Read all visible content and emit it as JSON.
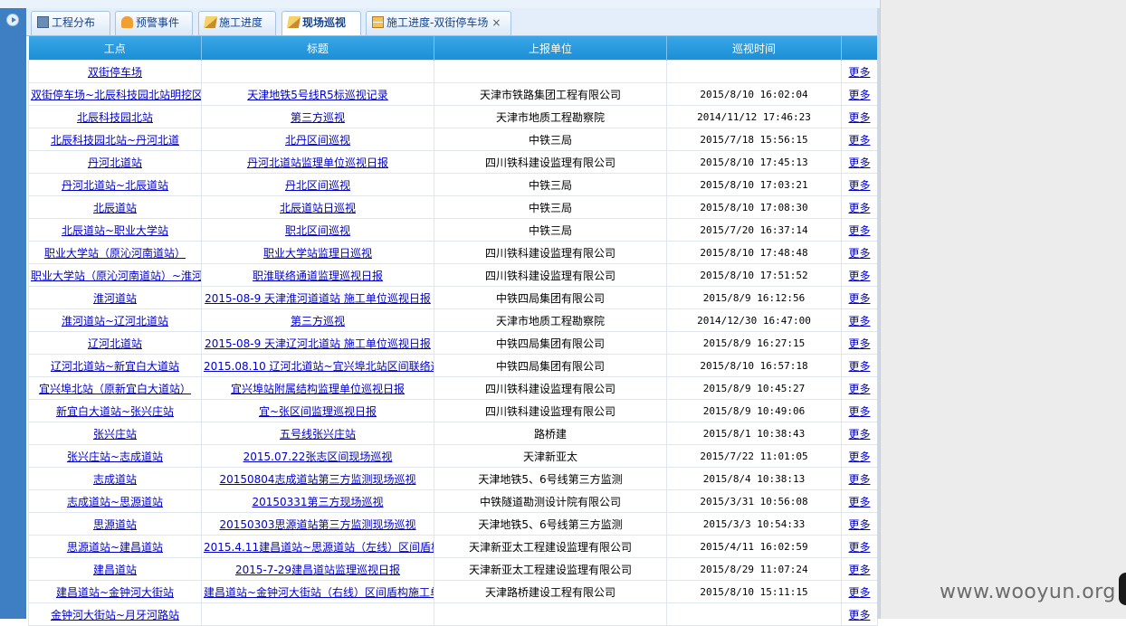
{
  "tabs": [
    {
      "label": "工程分布",
      "icon": "document-icon"
    },
    {
      "label": "预警事件",
      "icon": "bell-icon"
    },
    {
      "label": "施工进度",
      "icon": "pencil-icon"
    },
    {
      "label": "现场巡视",
      "icon": "pencil-icon",
      "active": true
    },
    {
      "label": "施工进度-双街停车场",
      "icon": "hourglass-icon",
      "closable": true,
      "close": "×"
    }
  ],
  "table": {
    "headers": [
      "工点",
      "标题",
      "上报单位",
      "巡视时间",
      ""
    ],
    "more_label": "更多",
    "rows": [
      {
        "site": "双街停车场",
        "title": "",
        "unit": "",
        "time": ""
      },
      {
        "site": "双街停车场~北辰科技园北站明挖区",
        "title": "天津地铁5号线R5标巡视记录",
        "unit": "天津市铁路集团工程有限公司",
        "time": "2015/8/10 16:02:04"
      },
      {
        "site": "北辰科技园北站",
        "title": "第三方巡视",
        "unit": "天津市地质工程勘察院",
        "time": "2014/11/12 17:46:23"
      },
      {
        "site": "北辰科技园北站~丹河北道",
        "title": "北丹区间巡视",
        "unit": "中铁三局",
        "time": "2015/7/18 15:56:15"
      },
      {
        "site": "丹河北道站",
        "title": "丹河北道站监理单位巡视日报",
        "unit": "四川铁科建设监理有限公司",
        "time": "2015/8/10 17:45:13"
      },
      {
        "site": "丹河北道站~北辰道站",
        "title": "丹北区间巡视",
        "unit": "中铁三局",
        "time": "2015/8/10 17:03:21"
      },
      {
        "site": "北辰道站",
        "title": "北辰道站日巡视",
        "unit": "中铁三局",
        "time": "2015/8/10 17:08:30"
      },
      {
        "site": "北辰道站~职业大学站",
        "title": "职北区间巡视",
        "unit": "中铁三局",
        "time": "2015/7/20 16:37:14"
      },
      {
        "site": "职业大学站（原沁河南道站）",
        "title": "职业大学站监理日巡视",
        "unit": "四川铁科建设监理有限公司",
        "time": "2015/8/10 17:48:48"
      },
      {
        "site": "职业大学站（原沁河南道站）~淮河",
        "title": "职淮联络通道监理巡视日报",
        "unit": "四川铁科建设监理有限公司",
        "time": "2015/8/10 17:51:52"
      },
      {
        "site": "淮河道站",
        "title": "2015-08-9 天津淮河道道站 施工单位巡视日报",
        "unit": "中铁四局集团有限公司",
        "time": "2015/8/9 16:12:56"
      },
      {
        "site": "淮河道站~辽河北道站",
        "title": "第三方巡视",
        "unit": "天津市地质工程勘察院",
        "time": "2014/12/30 16:47:00"
      },
      {
        "site": "辽河北道站",
        "title": "2015-08-9 天津辽河北道站 施工单位巡视日报",
        "unit": "中铁四局集团有限公司",
        "time": "2015/8/9 16:27:15"
      },
      {
        "site": "辽河北道站~新宜白大道站",
        "title": "2015.08.10 辽河北道站~宜兴埠北站区间联络通",
        "unit": "中铁四局集团有限公司",
        "time": "2015/8/10 16:57:18"
      },
      {
        "site": "宜兴埠北站（原新宜白大道站）",
        "title": "宜兴埠站附属结构监理单位巡视日报",
        "unit": "四川铁科建设监理有限公司",
        "time": "2015/8/9 10:45:27"
      },
      {
        "site": "新宜白大道站~张兴庄站",
        "title": "宜~张区间监理巡视日报",
        "unit": "四川铁科建设监理有限公司",
        "time": "2015/8/9 10:49:06"
      },
      {
        "site": "张兴庄站",
        "title": "五号线张兴庄站",
        "unit": "路桥建",
        "time": "2015/8/1 10:38:43"
      },
      {
        "site": "张兴庄站~志成道站",
        "title": "2015.07.22张志区间现场巡视",
        "unit": "天津新亚太",
        "time": "2015/7/22 11:01:05"
      },
      {
        "site": "志成道站",
        "title": "20150804志成道站第三方监测现场巡视",
        "unit": "天津地铁5、6号线第三方监测",
        "time": "2015/8/4 10:38:13"
      },
      {
        "site": "志成道站~思源道站",
        "title": "20150331第三方现场巡视",
        "unit": "中铁隧道勘测设计院有限公司",
        "time": "2015/3/31 10:56:08"
      },
      {
        "site": "思源道站",
        "title": "20150303思源道站第三方监测现场巡视",
        "unit": "天津地铁5、6号线第三方监测",
        "time": "2015/3/3 10:54:33"
      },
      {
        "site": "思源道站~建昌道站",
        "title": "2015.4.11建昌道站~思源道站（左线）区间盾构",
        "unit": "天津新亚太工程建设监理有限公司",
        "time": "2015/4/11 16:02:59"
      },
      {
        "site": "建昌道站",
        "title": "2015-7-29建昌道站监理巡视日报",
        "unit": "天津新亚太工程建设监理有限公司",
        "time": "2015/8/29 11:07:24"
      },
      {
        "site": "建昌道站~金钟河大街站",
        "title": "建昌道站~金钟河大街站（右线）区间盾构施工单",
        "unit": "天津路桥建设工程有限公司",
        "time": "2015/8/10 15:11:15"
      },
      {
        "site": "金钟河大街站~月牙河路站",
        "title": "",
        "unit": "",
        "time": ""
      }
    ]
  },
  "watermark": "www.wooyun.org"
}
